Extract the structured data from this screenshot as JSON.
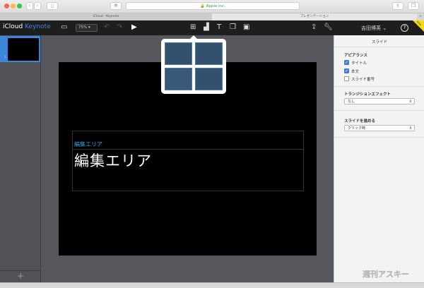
{
  "browser": {
    "url": "Apple Inc.",
    "tabs": [
      "iCloud - Keynote",
      "プレゼンテーション"
    ],
    "new_tab": "+"
  },
  "toolbar": {
    "brand_icloud": "iCloud",
    "brand_app": "Keynote",
    "zoom": "75%",
    "user": "吉田博英 ⌄",
    "help": "?",
    "beta": "beta"
  },
  "slide": {
    "number": "1",
    "subtitle": "編集エリア",
    "title": "編集エリア"
  },
  "panel": {
    "title": "スライド",
    "appearance": "アピアランス",
    "options": [
      {
        "label": "タイトル",
        "checked": true
      },
      {
        "label": "本文",
        "checked": true
      },
      {
        "label": "スライド番号",
        "checked": false
      }
    ],
    "transition_label": "トランジションエフェクト",
    "transition_value": "なし",
    "advance_label": "スライドを進める",
    "advance_value": "クリック時"
  },
  "sidebar": {
    "add": "+"
  },
  "watermark": "週刊アスキー",
  "colors": {
    "accent": "#3b7dd8",
    "toolbar": "#1e1e1e",
    "canvas": "#56575c",
    "subtitle": "#39a0e0"
  }
}
